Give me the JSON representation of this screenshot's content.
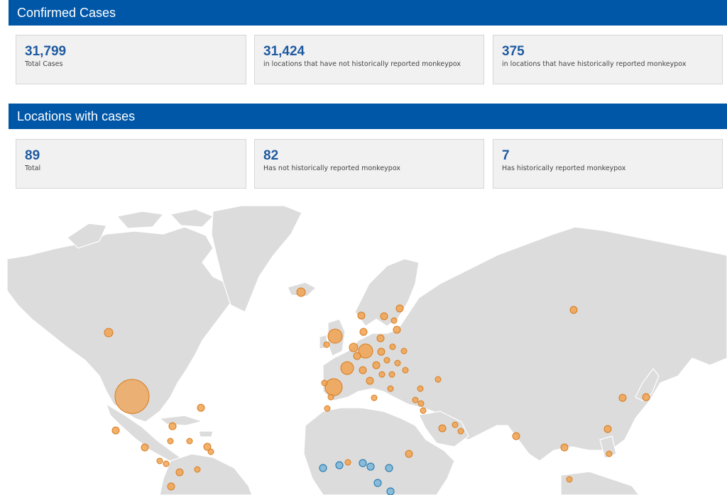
{
  "confirmed": {
    "title": "Confirmed Cases",
    "cards": [
      {
        "value": "31,799",
        "label": "Total Cases"
      },
      {
        "value": "31,424",
        "label": "in locations that have not historically reported monkeypox"
      },
      {
        "value": "375",
        "label": "in locations that have historically reported monkeypox"
      }
    ]
  },
  "locations": {
    "title": "Locations with cases",
    "cards": [
      {
        "value": "89",
        "label": "Total"
      },
      {
        "value": "82",
        "label": "Has not historically reported monkeypox"
      },
      {
        "value": "7",
        "label": "Has historically reported monkeypox"
      }
    ]
  },
  "map": {
    "colors": {
      "land": "#dcdcdc",
      "not_historically": "#f0a250",
      "historically": "#7fb8d9",
      "header": "#0057a8",
      "value_text": "#1f5aa0"
    }
  }
}
